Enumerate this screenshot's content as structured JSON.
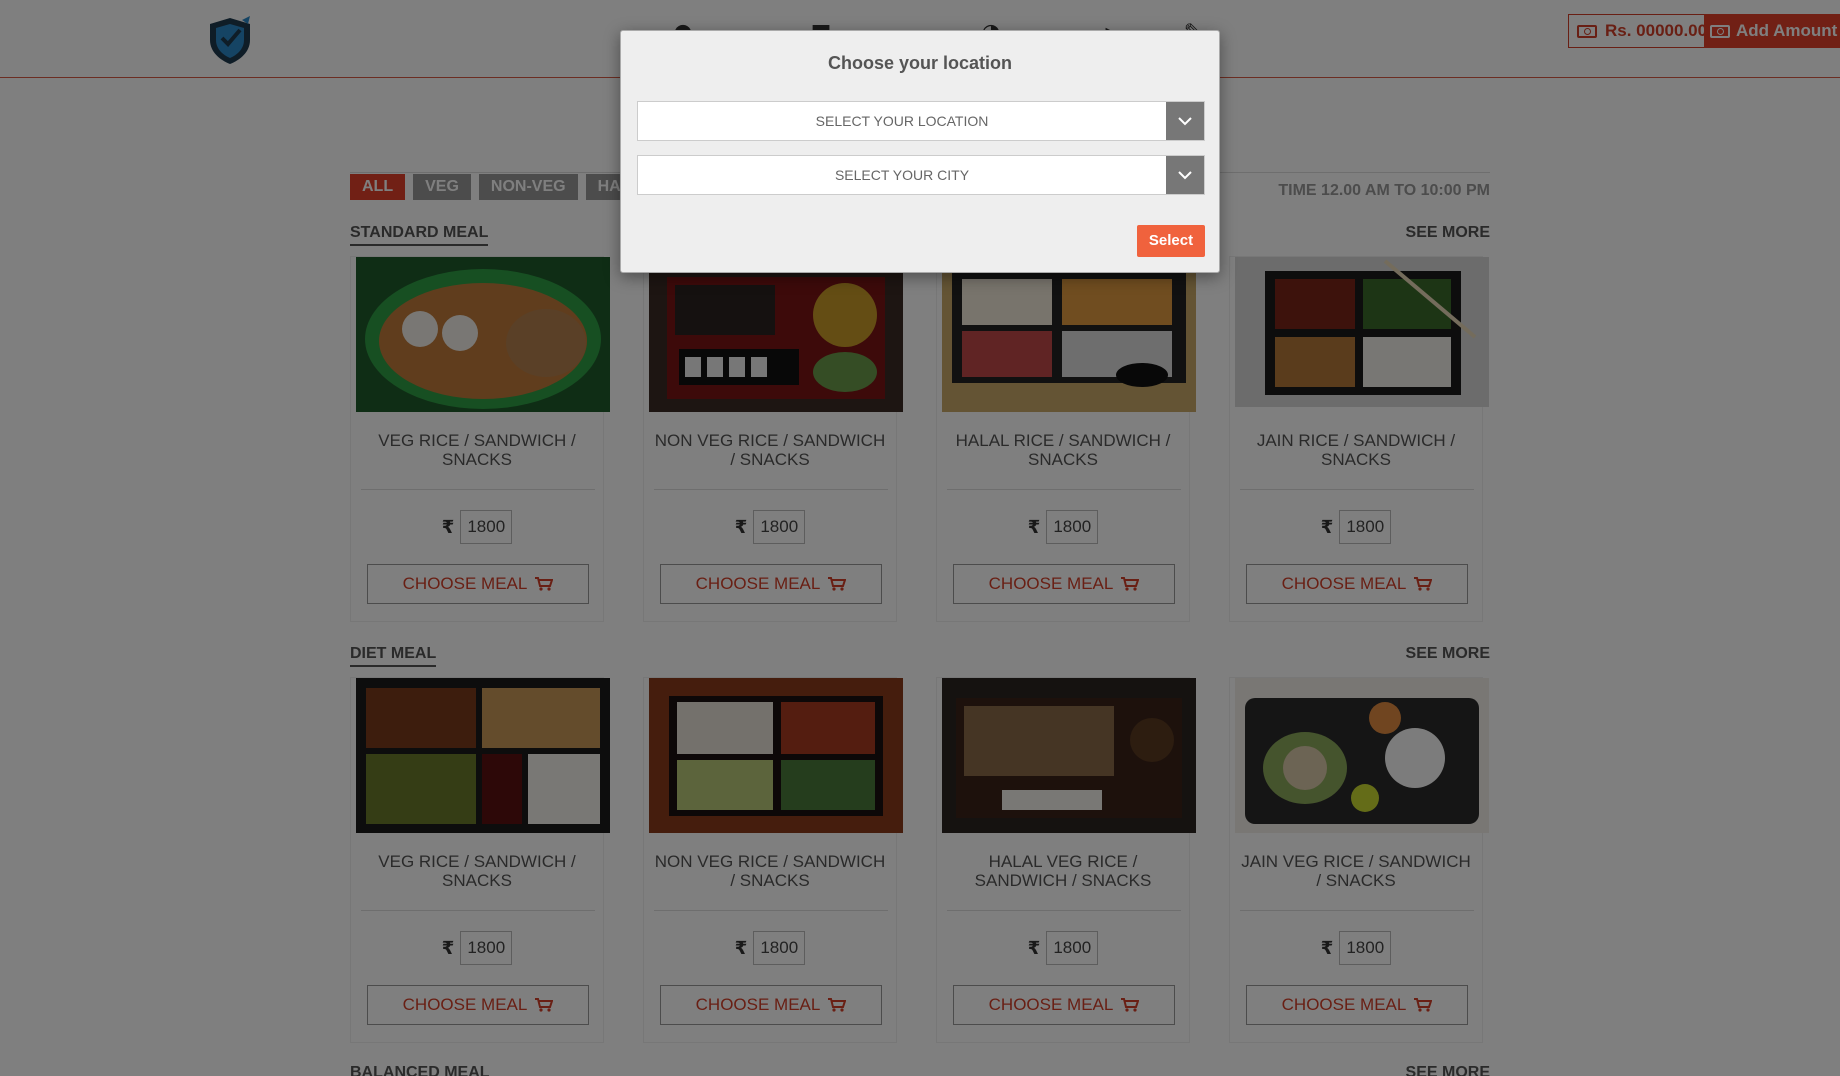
{
  "header": {
    "wallet_balance": "Rs. 00000.00",
    "add_amount_label": "Add Amount"
  },
  "filters": [
    {
      "label": "ALL",
      "active": true
    },
    {
      "label": "VEG",
      "active": false
    },
    {
      "label": "NON-VEG",
      "active": false
    },
    {
      "label": "HAL",
      "active": false
    }
  ],
  "timing": "TIME 12.00 AM TO 10:00 PM",
  "sections": [
    {
      "title": "STANDARD MEAL",
      "see_more": "SEE MORE",
      "items": [
        {
          "name": "VEG RICE / SANDWICH / SNACKS",
          "price": "1800",
          "button": "CHOOSE MEAL"
        },
        {
          "name": "NON VEG RICE / SANDWICH / SNACKS",
          "price": "1800",
          "button": "CHOOSE MEAL"
        },
        {
          "name": "HALAL RICE / SANDWICH / SNACKS",
          "price": "1800",
          "button": "CHOOSE MEAL"
        },
        {
          "name": "JAIN RICE / SANDWICH / SNACKS",
          "price": "1800",
          "button": "CHOOSE MEAL"
        }
      ]
    },
    {
      "title": "DIET MEAL",
      "see_more": "SEE MORE",
      "items": [
        {
          "name": "VEG RICE / SANDWICH / SNACKS",
          "price": "1800",
          "button": "CHOOSE MEAL"
        },
        {
          "name": "NON VEG RICE / SANDWICH / SNACKS",
          "price": "1800",
          "button": "CHOOSE MEAL"
        },
        {
          "name": "HALAL VEG RICE / SANDWICH / SNACKS",
          "price": "1800",
          "button": "CHOOSE MEAL"
        },
        {
          "name": "JAIN VEG RICE / SANDWICH / SNACKS",
          "price": "1800",
          "button": "CHOOSE MEAL"
        }
      ]
    },
    {
      "title": "BALANCED MEAL",
      "see_more": "SEE MORE"
    }
  ],
  "currency_symbol": "₹",
  "modal": {
    "title": "Choose your location",
    "location_select": "SELECT YOUR LOCATION",
    "city_select": "SELECT YOUR CITY",
    "select_button": "Select"
  },
  "colors": {
    "accent": "#e2412a",
    "modal_button": "#f0623d"
  }
}
